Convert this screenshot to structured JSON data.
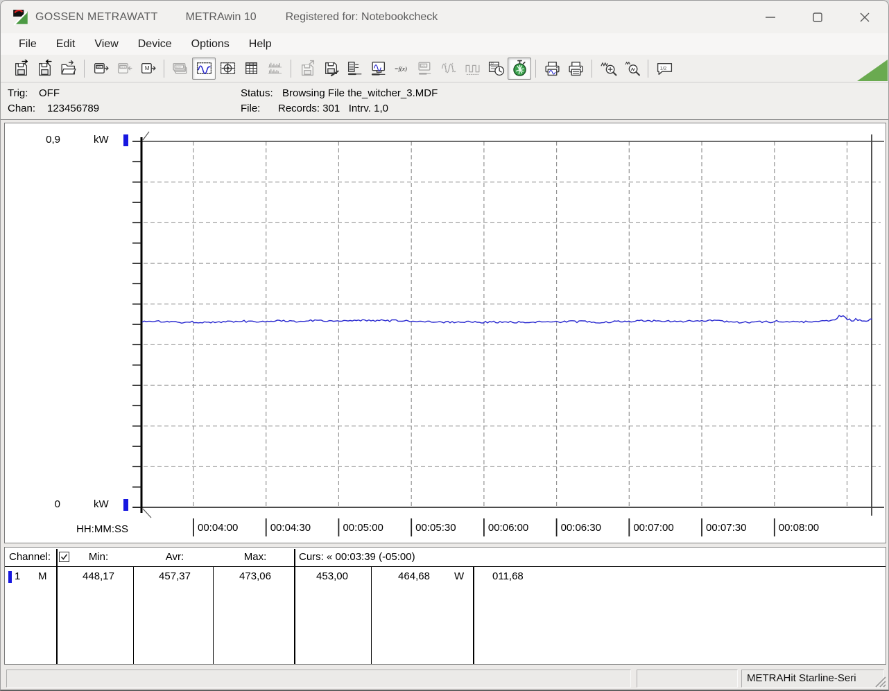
{
  "window": {
    "brand": "GOSSEN METRAWATT",
    "app": "METRAwin 10",
    "registered": "Registered for: Notebookcheck"
  },
  "menu": {
    "items": [
      "File",
      "Edit",
      "View",
      "Device",
      "Options",
      "Help"
    ]
  },
  "toolbar": {
    "buttons": [
      {
        "name": "save-export",
        "icon": "floppy-out"
      },
      {
        "name": "save-import",
        "icon": "floppy-in"
      },
      {
        "name": "open-file",
        "icon": "folder"
      },
      {
        "sep": true
      },
      {
        "name": "read-device-321",
        "icon": "device321-out"
      },
      {
        "name": "write-device-321",
        "icon": "device321-in",
        "disabled": true
      },
      {
        "name": "read-memory",
        "icon": "deviceM"
      },
      {
        "sep": true
      },
      {
        "name": "multimeter-view",
        "icon": "meter1257",
        "disabled": true
      },
      {
        "name": "chart-view",
        "icon": "chart",
        "pressed": true
      },
      {
        "name": "scope-view",
        "icon": "crosshair"
      },
      {
        "name": "table-view",
        "icon": "table"
      },
      {
        "name": "histogram-view",
        "icon": "histogram",
        "disabled": true
      },
      {
        "sep": true
      },
      {
        "name": "export-data",
        "icon": "floppy-up",
        "disabled": true
      },
      {
        "name": "save-config",
        "icon": "floppy-tool"
      },
      {
        "name": "channel-config",
        "icon": "list-tool"
      },
      {
        "name": "display-config",
        "icon": "monitor-tool"
      },
      {
        "name": "formula",
        "icon": "fx"
      },
      {
        "name": "device-config",
        "icon": "meter-tool",
        "disabled": true
      },
      {
        "name": "analog-trigger",
        "icon": "sine",
        "disabled": true
      },
      {
        "name": "pulse-trigger",
        "icon": "pulse",
        "disabled": true
      },
      {
        "name": "date-time",
        "icon": "calclock"
      },
      {
        "name": "interval-timer",
        "icon": "stopwatch",
        "pressed": true
      },
      {
        "sep": true
      },
      {
        "name": "print-preview",
        "icon": "printer-chart"
      },
      {
        "name": "print",
        "icon": "printer"
      },
      {
        "sep": true
      },
      {
        "name": "zoom-in",
        "icon": "zoom-in"
      },
      {
        "name": "zoom-out",
        "icon": "zoom-out"
      },
      {
        "sep": true
      },
      {
        "name": "annotation",
        "icon": "note"
      }
    ]
  },
  "status_strip": {
    "trig": {
      "label": "Trig:",
      "value": "OFF"
    },
    "chan": {
      "label": "Chan:",
      "value": "123456789"
    },
    "status": {
      "label": "Status:",
      "value": "Browsing File the_witcher_3.MDF"
    },
    "file": {
      "label": "File:",
      "value": "Records: 301   Intrv. 1,0"
    }
  },
  "chart_data": {
    "type": "line",
    "title": "",
    "y_axis": {
      "top_label": "0,9",
      "bottom_label": "0",
      "unit": "kW",
      "range_w": [
        0,
        900
      ],
      "minor_tick_w": 50,
      "grid_step_w": 100
    },
    "x_axis": {
      "label": "HH:MM:SS",
      "ticks": [
        "00:04:00",
        "00:04:30",
        "00:05:00",
        "00:05:30",
        "00:06:00",
        "00:06:30",
        "00:07:00",
        "00:07:30",
        "00:08:00"
      ],
      "tick_interval_s": 30
    },
    "grid": true,
    "records": 301,
    "interval_s": 1.0,
    "series": [
      {
        "name": "Channel 1 (M) Power",
        "unit": "W",
        "color": "#2626cf",
        "min": 448.17,
        "avg": 457.37,
        "max": 473.06,
        "description": "Nearly constant ~457 W with small noise across the visible window; brief rise toward ~473 W near the right edge (~00:08:20)."
      }
    ],
    "cursor": {
      "time": "00:03:39",
      "offset": "(-05:00)",
      "value1_w": 453.0,
      "value2_w": 464.68,
      "delta": "011,68"
    }
  },
  "table": {
    "header": {
      "channel": "Channel:",
      "min": "Min:",
      "avr": "Avr:",
      "max": "Max:",
      "cursor": "Curs: « 00:03:39 (-05:00)"
    },
    "rows": [
      {
        "num": "1",
        "mode": "M",
        "min": "448,17",
        "avr": "457,37",
        "max": "473,06",
        "curs_a": "453,00",
        "curs_b": "464,68",
        "unit": "W",
        "delta": "011,68"
      }
    ]
  },
  "status_bar": {
    "device": "METRAHit Starline-Seri"
  }
}
